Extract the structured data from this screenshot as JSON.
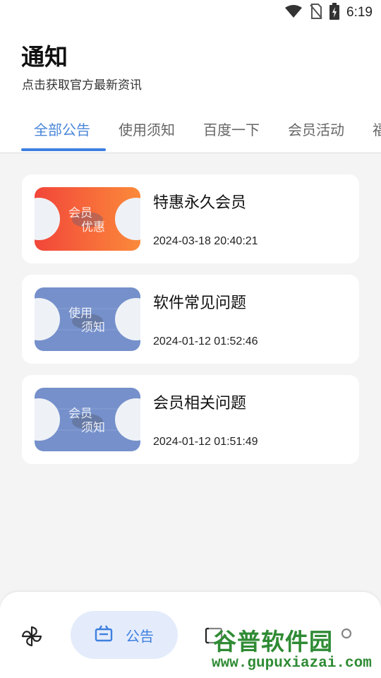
{
  "status_bar": {
    "time": "6:19",
    "icons": [
      "wifi-icon",
      "no-sim-icon",
      "battery-charging-icon"
    ]
  },
  "header": {
    "title": "通知",
    "subtitle": "点击获取官方最新资讯"
  },
  "tabs": [
    {
      "label": "全部公告",
      "active": true
    },
    {
      "label": "使用须知",
      "active": false
    },
    {
      "label": "百度一下",
      "active": false
    },
    {
      "label": "会员活动",
      "active": false
    },
    {
      "label": "福",
      "active": false
    }
  ],
  "notices": [
    {
      "title": "特惠永久会员",
      "date": "2024-03-18 20:40:21",
      "thumb_line1": "会员",
      "thumb_line2": "优惠",
      "thumb_colors": [
        "#f2463a",
        "#fb8a3a"
      ]
    },
    {
      "title": "软件常见问题",
      "date": "2024-01-12 01:52:46",
      "thumb_line1": "使用",
      "thumb_line2": "须知",
      "thumb_colors": [
        "#6d87c6",
        "#7d95cf"
      ]
    },
    {
      "title": "会员相关问题",
      "date": "2024-01-12 01:51:49",
      "thumb_line1": "会员",
      "thumb_line2": "须知",
      "thumb_colors": [
        "#6d87c6",
        "#7d95cf"
      ]
    }
  ],
  "bottom_nav": {
    "active_label": "公告",
    "icons": [
      "pinwheel-icon",
      "announcement-icon",
      "document-icon",
      "profile-icon"
    ]
  },
  "watermark": {
    "main": "谷普软件园",
    "url": "www.gupuxiazai.com"
  },
  "colors": {
    "accent": "#3f7fe0",
    "tab_active": "#4a86d9",
    "background": "#f4f4f5"
  }
}
